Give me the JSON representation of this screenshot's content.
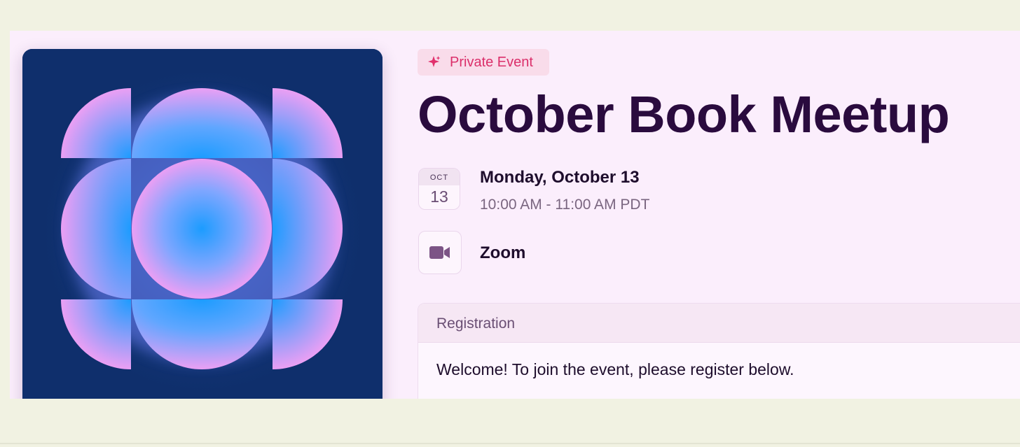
{
  "event": {
    "badge": {
      "label": "Private Event",
      "icon": "sparkle-icon"
    },
    "title": "October Book Meetup",
    "date": {
      "month": "OCT",
      "day": "13",
      "primary": "Monday, October 13",
      "time": "10:00 AM - 11:00 AM PDT",
      "icon": "calendar-icon"
    },
    "location": {
      "label": "Zoom",
      "icon": "video-camera-icon"
    },
    "registration": {
      "header": "Registration",
      "message": "Welcome! To join the event, please register below."
    }
  },
  "colors": {
    "page_background": "#fbeefc",
    "outer_background": "#f1f2e2",
    "title": "#2a0b3e",
    "badge_text": "#db2f6a",
    "badge_background": "#f9dcea",
    "cover_background": "#0f2f6c",
    "cover_pink": "#e79ef6",
    "cover_blue": "#1c9cff"
  }
}
